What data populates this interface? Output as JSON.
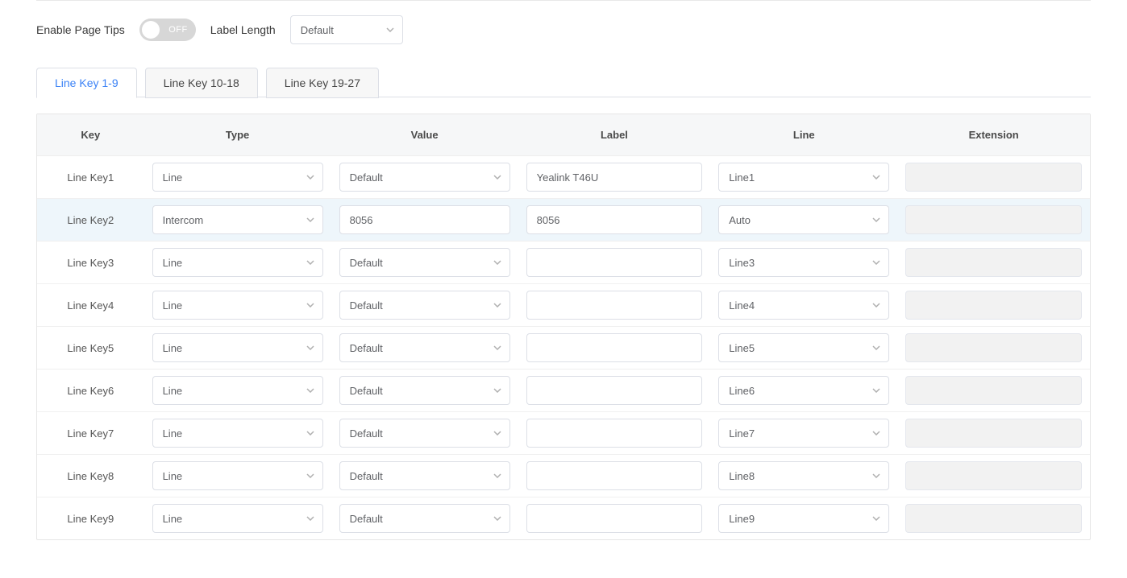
{
  "controls": {
    "enable_page_tips_label": "Enable Page Tips",
    "toggle_state": "OFF",
    "label_length_label": "Label Length",
    "label_length_value": "Default"
  },
  "tabs": [
    {
      "label": "Line Key 1-9",
      "active": true
    },
    {
      "label": "Line Key 10-18",
      "active": false
    },
    {
      "label": "Line Key 19-27",
      "active": false
    }
  ],
  "columns": {
    "key": "Key",
    "type": "Type",
    "value": "Value",
    "label": "Label",
    "line": "Line",
    "extension": "Extension"
  },
  "rows": [
    {
      "key": "Line Key1",
      "type": "Line",
      "value": "Default",
      "value_is_select": true,
      "label": "Yealink T46U",
      "line": "Line1",
      "extension": "",
      "highlight": false
    },
    {
      "key": "Line Key2",
      "type": "Intercom",
      "value": "8056",
      "value_is_select": false,
      "label": "8056",
      "line": "Auto",
      "extension": "",
      "highlight": true
    },
    {
      "key": "Line Key3",
      "type": "Line",
      "value": "Default",
      "value_is_select": true,
      "label": "",
      "line": "Line3",
      "extension": "",
      "highlight": false
    },
    {
      "key": "Line Key4",
      "type": "Line",
      "value": "Default",
      "value_is_select": true,
      "label": "",
      "line": "Line4",
      "extension": "",
      "highlight": false
    },
    {
      "key": "Line Key5",
      "type": "Line",
      "value": "Default",
      "value_is_select": true,
      "label": "",
      "line": "Line5",
      "extension": "",
      "highlight": false
    },
    {
      "key": "Line Key6",
      "type": "Line",
      "value": "Default",
      "value_is_select": true,
      "label": "",
      "line": "Line6",
      "extension": "",
      "highlight": false
    },
    {
      "key": "Line Key7",
      "type": "Line",
      "value": "Default",
      "value_is_select": true,
      "label": "",
      "line": "Line7",
      "extension": "",
      "highlight": false
    },
    {
      "key": "Line Key8",
      "type": "Line",
      "value": "Default",
      "value_is_select": true,
      "label": "",
      "line": "Line8",
      "extension": "",
      "highlight": false
    },
    {
      "key": "Line Key9",
      "type": "Line",
      "value": "Default",
      "value_is_select": true,
      "label": "",
      "line": "Line9",
      "extension": "",
      "highlight": false
    }
  ]
}
